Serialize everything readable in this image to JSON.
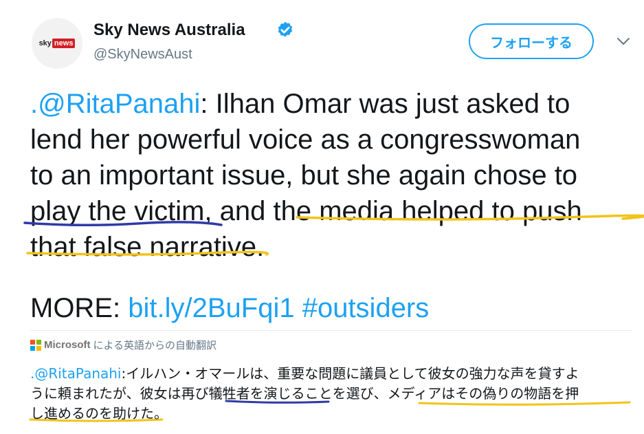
{
  "header": {
    "avatar_sky": "sky",
    "avatar_news": "news",
    "display_name": "Sky News Australia",
    "handle": "@SkyNewsAust",
    "follow_label": "フォローする"
  },
  "tweet": {
    "line1_link": ".@RitaPanahi",
    "line1_rest": ": Ilhan Omar was just asked to",
    "line2": "lend her powerful voice as a congresswoman",
    "line3": "to an important issue, but she again chose to",
    "line4": "play the victim, and the media helped to push",
    "line5": "that false narrative.",
    "more_label": "MORE: ",
    "more_link": "bit.ly/2BuFqi1",
    "more_hashtag": "#outsiders"
  },
  "translation": {
    "provider": "Microsoft",
    "note": "による英語からの自動翻訳",
    "line1_link": ".@RitaPanahi",
    "line1_rest": ":イルハン・オマールは、重要な問題に議員として彼女の強力な声を貸すよ",
    "line2": "うに頼まれたが、彼女は再び犠牲者を演じることを選び、メディアはその偽りの物語を押",
    "line3": "し進めるのを助けた。"
  },
  "colors": {
    "link": "#1da1f2",
    "annotation_blue": "#2f3aa8",
    "annotation_yellow": "#f2c318"
  },
  "icons": {
    "verified": "verified-badge-icon",
    "chevron": "chevron-down-icon"
  }
}
